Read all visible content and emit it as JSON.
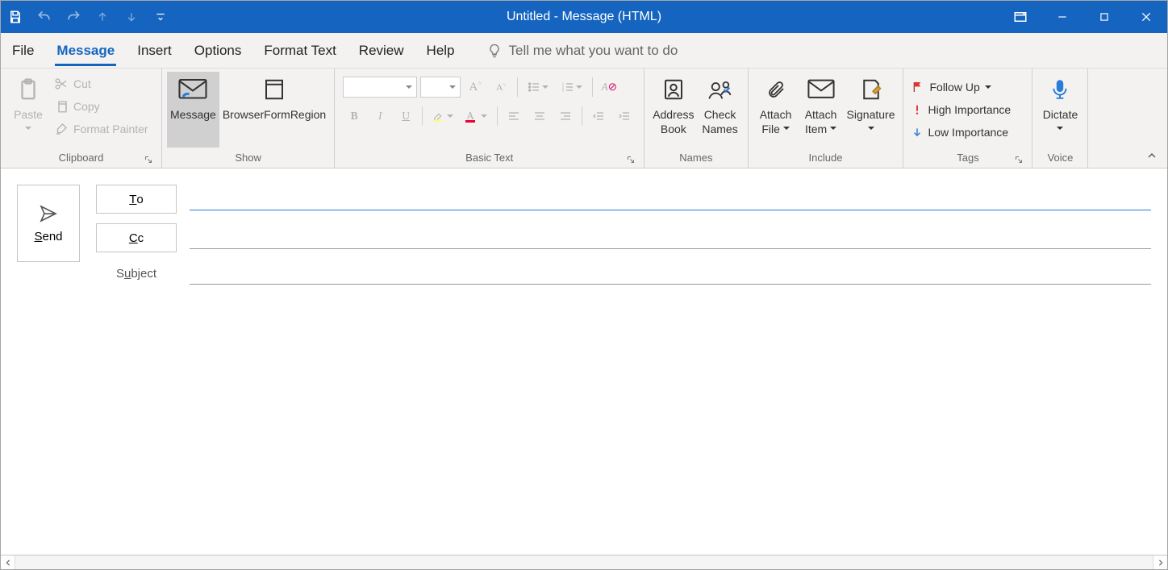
{
  "title": "Untitled  -  Message (HTML)",
  "qa": {
    "save": "Save",
    "undo": "Undo",
    "redo": "Redo",
    "prev": "Previous Item",
    "next": "Next Item",
    "customize": "Customize Quick Access Toolbar"
  },
  "win": {
    "mode": "Ribbon Display Options",
    "min": "Minimize",
    "max": "Maximize",
    "close": "Close"
  },
  "tabs": {
    "file": "File",
    "message": "Message",
    "insert": "Insert",
    "options": "Options",
    "format": "Format Text",
    "review": "Review",
    "help": "Help"
  },
  "tell_me_placeholder": "Tell me what you want to do",
  "clipboard": {
    "paste": "Paste",
    "cut": "Cut",
    "copy": "Copy",
    "format_painter": "Format Painter",
    "group": "Clipboard"
  },
  "show": {
    "message": "Message",
    "bfr": "BrowserFormRegion",
    "group": "Show"
  },
  "basic_text": {
    "font_name": "",
    "font_size": "",
    "grow": "Increase Font Size",
    "shrink": "Decrease Font Size",
    "bullets": "Bullets",
    "numbering": "Numbering",
    "clear": "Clear All Formatting",
    "bold": "B",
    "italic": "I",
    "underline": "U",
    "highlight": "Text Highlight Color",
    "fontcolor": "Font Color",
    "align_left": "Align Left",
    "align_center": "Center",
    "align_right": "Align Right",
    "dec_indent": "Decrease Indent",
    "inc_indent": "Increase Indent",
    "group": "Basic Text"
  },
  "names": {
    "address": "Address Book",
    "check_names": "Check Names",
    "group": "Names"
  },
  "include": {
    "attach_file": "Attach File",
    "attach_item": "Attach Item",
    "signature": "Signature",
    "group": "Include"
  },
  "tags": {
    "follow_up": "Follow Up",
    "high": "High Importance",
    "low": "Low Importance",
    "group": "Tags"
  },
  "voice": {
    "dictate": "Dictate",
    "group": "Voice"
  },
  "compose": {
    "send": "Send",
    "to": "To",
    "cc": "Cc",
    "subject": "Subject",
    "to_value": "",
    "cc_value": "",
    "subject_value": ""
  }
}
